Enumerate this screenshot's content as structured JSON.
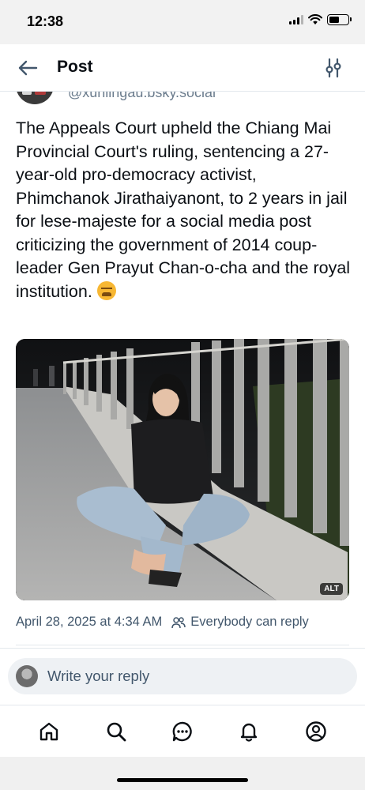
{
  "status_bar": {
    "time": "12:38"
  },
  "header": {
    "title": "Post",
    "back_icon": "arrow-left-icon",
    "filter_icon": "sliders-icon"
  },
  "post": {
    "author_handle": "@xunlingau.bsky.social",
    "text": "The Appeals Court upheld the Chiang Mai Provincial Court's ruling, sentencing a 27-year-old pro-democracy activist, Phimchanok Jirathaiyanont, to 2 years in jail for lese-majeste for a social media post criticizing the government of 2014 coup-leader Gen Prayut Chan-o-cha and the royal institution.",
    "emoji_icon": "tired-face-emoji",
    "image_alt_badge": "ALT",
    "date": "April 28, 2025 at 4:34 AM",
    "reply_permission": "Everybody can reply"
  },
  "reply_bar": {
    "placeholder": "Write your reply"
  },
  "tabbar": {
    "items": [
      {
        "icon": "home-icon"
      },
      {
        "icon": "search-icon"
      },
      {
        "icon": "chat-icon"
      },
      {
        "icon": "bell-icon"
      },
      {
        "icon": "profile-icon"
      }
    ]
  },
  "colors": {
    "text": "#0b0f14",
    "secondary": "#42576c",
    "accent": "#1083fe",
    "divider": "#e3e8ed"
  }
}
